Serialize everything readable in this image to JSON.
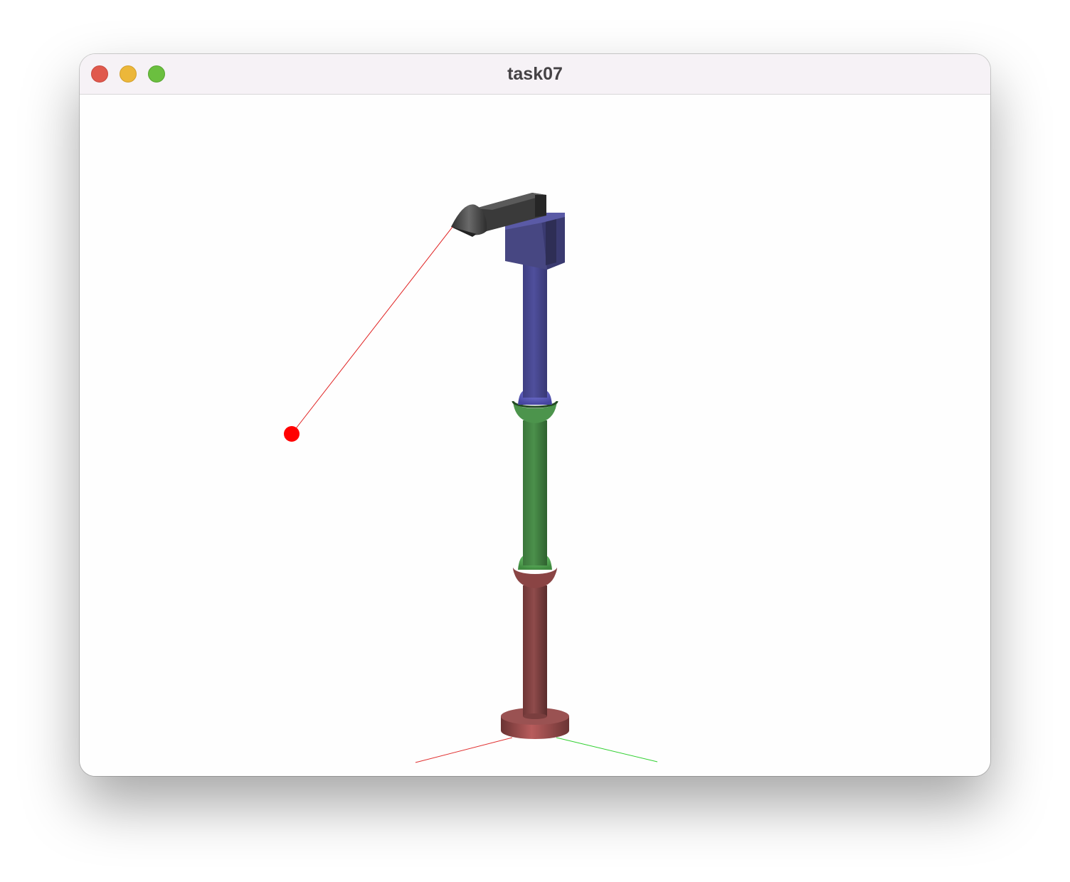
{
  "window": {
    "title": "task07",
    "controls": [
      "close",
      "minimize",
      "zoom"
    ]
  },
  "scene": {
    "description_icons": [
      "robot-arm",
      "target-point",
      "axes"
    ],
    "colors": {
      "base_link": "#8a4a4a",
      "middle_link": "#4a8a4a",
      "upper_link": "#4d4d94",
      "end_effector": "#3c3c3c",
      "target": "#ff0000",
      "x_axis": "#e03030",
      "y_axis": "#30d030"
    }
  }
}
